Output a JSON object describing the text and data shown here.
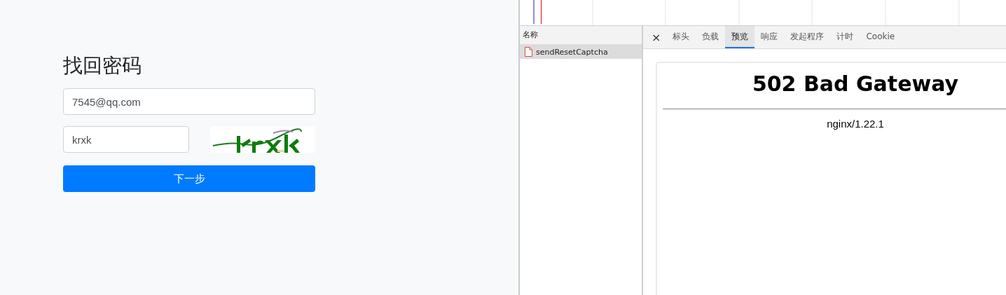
{
  "form": {
    "title": "找回密码",
    "email": {
      "value": "7545@qq.com"
    },
    "captcha_field": {
      "value": "krxk"
    },
    "submit": "下一步"
  },
  "devtools": {
    "name_header": "名称",
    "requests": [
      {
        "name": "sendResetCaptcha",
        "selected": true
      }
    ],
    "close": "×",
    "tabs": [
      {
        "label": "标头",
        "selected": false
      },
      {
        "label": "负载",
        "selected": false
      },
      {
        "label": "预览",
        "selected": true
      },
      {
        "label": "响应",
        "selected": false
      },
      {
        "label": "发起程序",
        "selected": false
      },
      {
        "label": "计时",
        "selected": false
      },
      {
        "label": "Cookie",
        "selected": false
      }
    ],
    "preview": {
      "heading": "502 Bad Gateway",
      "server": "nginx/1.22.1"
    }
  }
}
